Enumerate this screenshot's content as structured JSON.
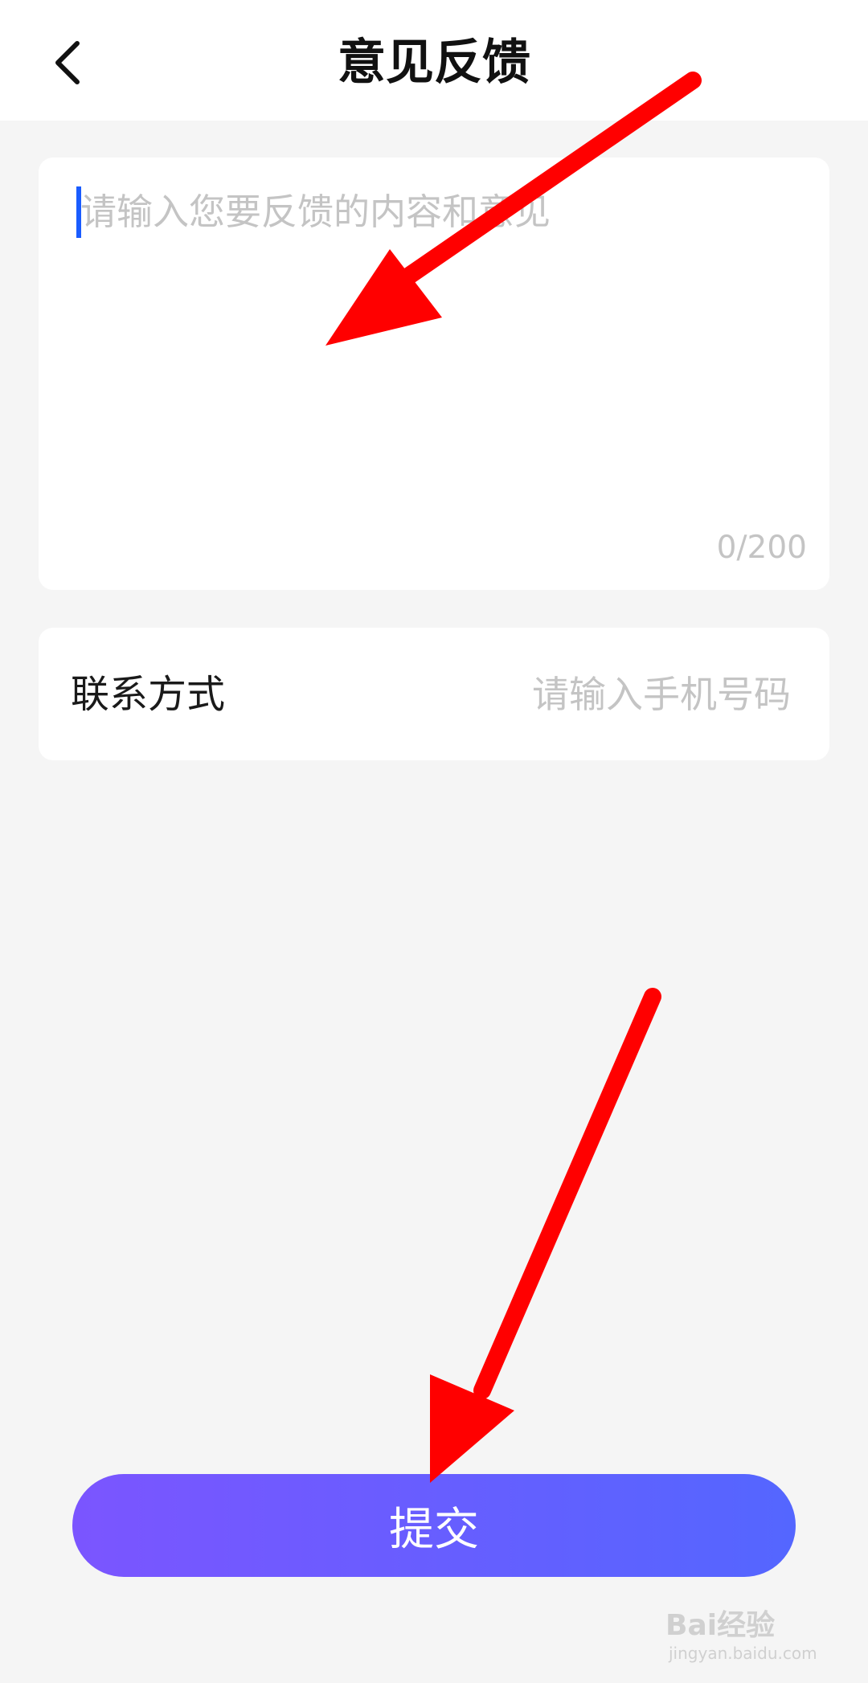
{
  "header": {
    "title": "意见反馈",
    "back_icon": "chevron-left-icon"
  },
  "feedback": {
    "placeholder": "请输入您要反馈的内容和意见",
    "counter": "0/200"
  },
  "contact": {
    "label": "联系方式",
    "placeholder": "请输入手机号码"
  },
  "submit_label": "提交",
  "watermark": {
    "logo": "Bai经验",
    "url": "jingyan.baidu.com"
  },
  "colors": {
    "background": "#f5f5f5",
    "caret": "#1a5cff",
    "button_gradient_start": "#7b55ff",
    "button_gradient_end": "#5466ff",
    "annotation_arrow": "#ff0000"
  }
}
